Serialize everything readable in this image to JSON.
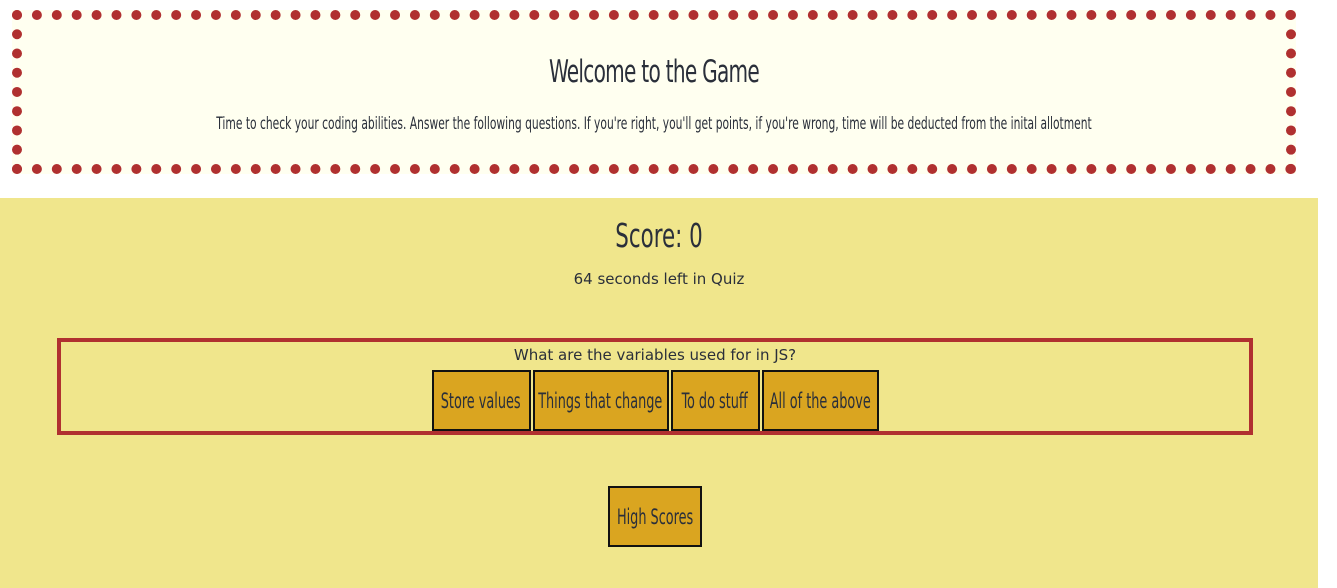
{
  "header": {
    "title": "Welcome to the Game",
    "subtitle": "Time to check your coding abilities. Answer the following questions. If you're right, you'll get points, if you're wrong, time will be deducted from the inital allotment"
  },
  "quiz": {
    "score_text": "Score: 0",
    "timer_text": "64 seconds left in Quiz",
    "question": "What are the variables used for in JS?",
    "answers": [
      {
        "label": "Store values"
      },
      {
        "label": "Things that change"
      },
      {
        "label": "To do stuff"
      },
      {
        "label": "All of the above"
      }
    ]
  },
  "footer": {
    "high_scores_label": "High Scores"
  },
  "colors": {
    "banner_bg": "#fffff0",
    "dot_border": "#b03030",
    "main_bg": "#f0e68c",
    "button_bg": "#daa520",
    "text": "#2a2f3a"
  }
}
